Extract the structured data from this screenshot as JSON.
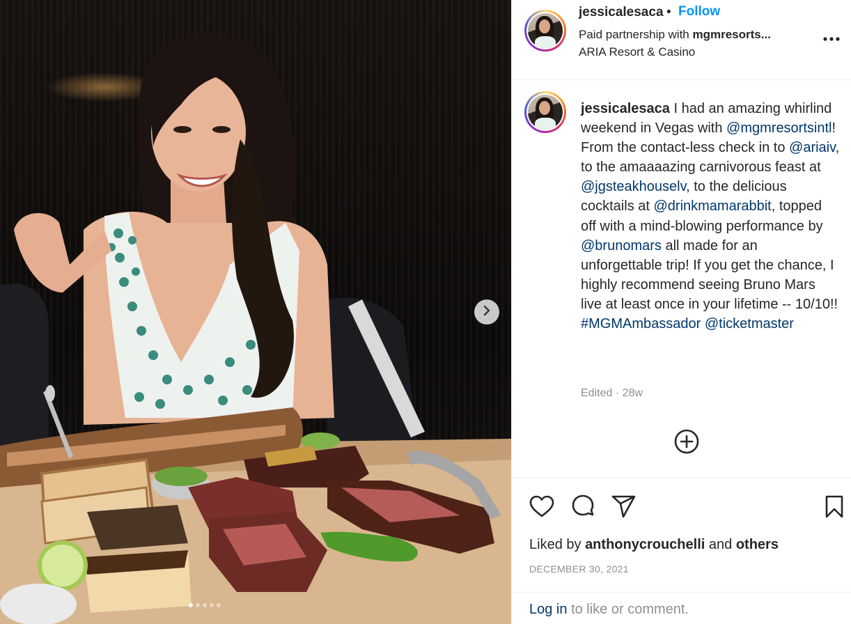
{
  "header": {
    "username": "jessicalesaca",
    "separator": "•",
    "follow_label": "Follow",
    "partnership_prefix": "Paid partnership with",
    "partner": "mgmresorts...",
    "location": "ARIA Resort & Casino"
  },
  "caption": {
    "username": "jessicalesaca",
    "segments": [
      " I had an amazing whirlind weekend in Vegas with ",
      "@mgmresortsintl",
      "! From the contact-less check in to ",
      "@ariaiv",
      ", to the amaaaazing carnivorous feast at ",
      "@jgsteakhouselv",
      ", to the delicious cocktails at ",
      "@drinkmamarabbit",
      ", topped off with a mind-blowing performance by ",
      "@brunomars",
      " all made for an unforgettable trip! If you get the chance, I highly recommend seeing Bruno Mars live at least once in your lifetime -- 10/10!! ",
      "#MGMAmbassador",
      " ",
      "@ticketmaster"
    ],
    "meta": "Edited · 28w"
  },
  "engagement": {
    "liked_prefix": "Liked by",
    "liked_user": "anthonycrouchelli",
    "liked_and": "and",
    "liked_others": "others",
    "date": "DECEMBER 30, 2021"
  },
  "login": {
    "link": "Log in",
    "suffix": "to like or comment."
  },
  "carousel": {
    "dots_total": 5,
    "active_index": 0
  },
  "icons": {
    "next": "chevron-right-icon",
    "more": "more-horizontal-icon",
    "add_comment": "plus-circle-icon",
    "like": "heart-icon",
    "comment": "comment-icon",
    "share": "send-icon",
    "save": "bookmark-icon"
  },
  "colors": {
    "follow": "#0095f6",
    "mention": "#00376b",
    "muted": "#8e8e8e",
    "text": "#262626"
  }
}
